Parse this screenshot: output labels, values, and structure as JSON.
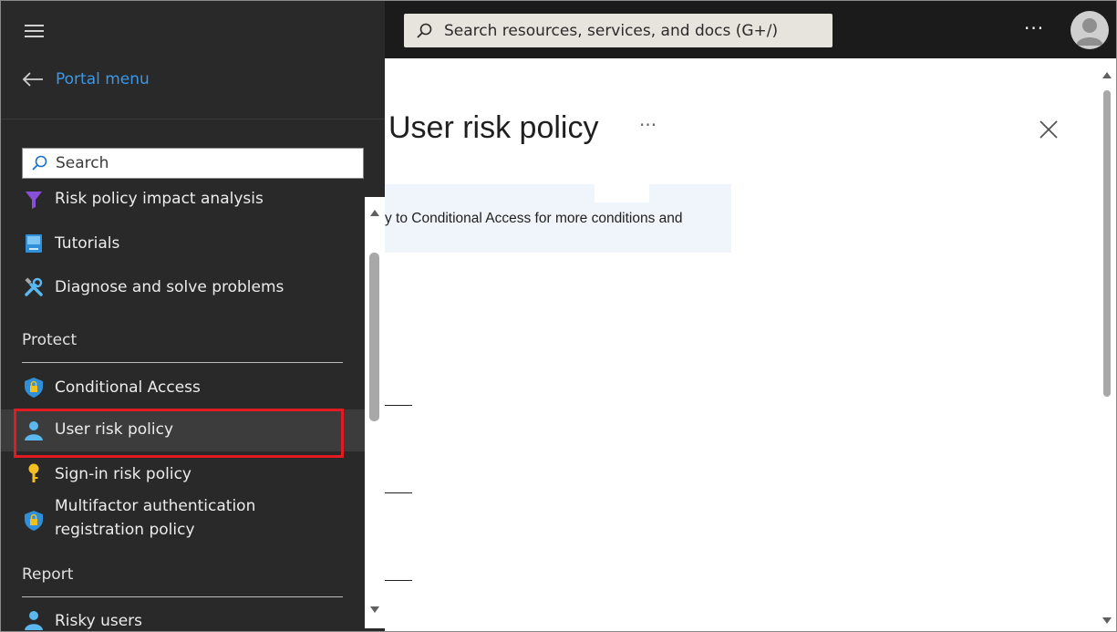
{
  "header": {
    "search_placeholder": "Search resources, services, and docs (G+/)",
    "more_label": "···"
  },
  "sidebar": {
    "back_label": "Portal menu",
    "search_placeholder": "Search",
    "items": [
      {
        "label": "Risk policy impact analysis",
        "icon": "funnel-icon"
      },
      {
        "label": "Tutorials",
        "icon": "book-icon"
      },
      {
        "label": "Diagnose and solve problems",
        "icon": "wrench-icon"
      }
    ],
    "sections": [
      {
        "heading": "Protect",
        "items": [
          {
            "label": "Conditional Access",
            "icon": "shield-lock-icon"
          },
          {
            "label": "User risk policy",
            "icon": "user-icon",
            "selected": true
          },
          {
            "label": "Sign-in risk policy",
            "icon": "key-icon"
          },
          {
            "label": "Multifactor authentication",
            "label2": "registration policy",
            "icon": "shield-lock-icon"
          }
        ]
      },
      {
        "heading": "Report",
        "items": [
          {
            "label": "Risky users",
            "icon": "users-icon"
          }
        ]
      }
    ]
  },
  "main": {
    "title": "User risk policy",
    "title_more": "···",
    "info_text": "y to Conditional Access for more conditions and"
  },
  "colors": {
    "highlight": "#e21b23",
    "link": "#3c97e6",
    "sidebar_bg": "#292929",
    "topbar_bg": "#1b1b1b"
  }
}
